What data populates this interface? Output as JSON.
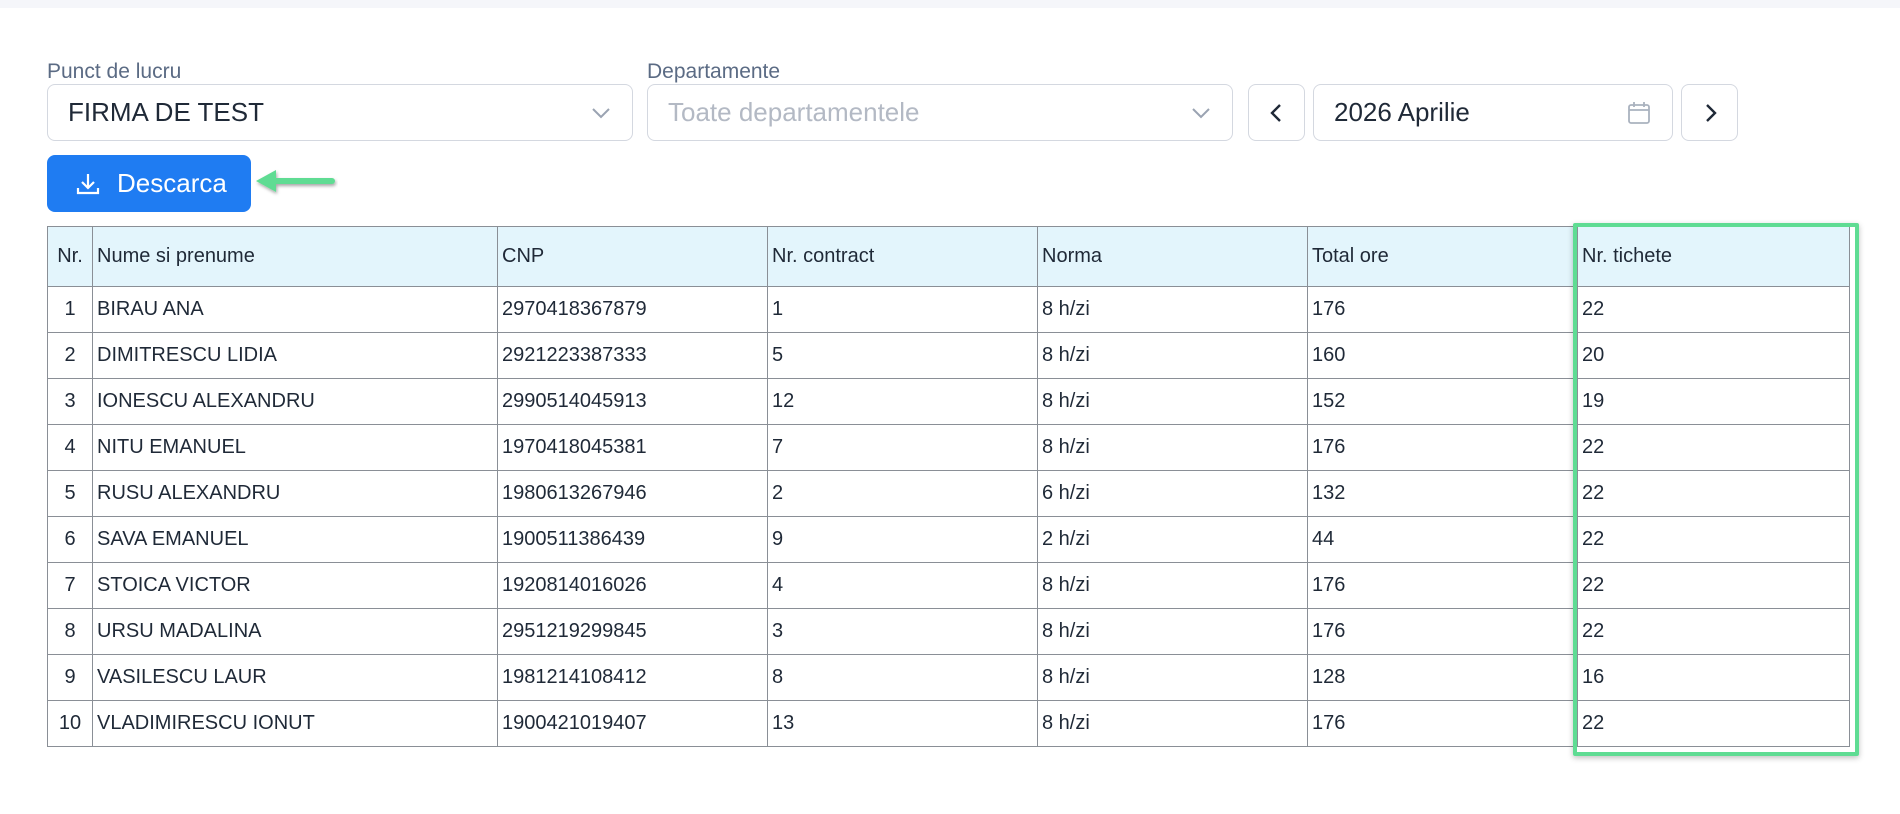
{
  "filters": {
    "workplace_label": "Punct de lucru",
    "workplace_value": "FIRMA DE TEST",
    "department_label": "Departamente",
    "department_placeholder": "Toate departamentele",
    "month_value": "2026 Aprilie"
  },
  "actions": {
    "download_label": "Descarca"
  },
  "icons": {
    "workplace_chevron": "chevron-down-icon",
    "department_chevron": "chevron-down-icon",
    "prev": "chevron-left-icon",
    "next": "chevron-right-icon",
    "calendar": "calendar-icon",
    "download": "download-icon",
    "annotation_arrow": "arrow-left-icon"
  },
  "colors": {
    "primary": "#1f7cf2",
    "header_bg": "#e3f5fc",
    "highlight": "#5fdc93"
  },
  "table": {
    "columns": [
      "Nr.",
      "Nume si prenume",
      "CNP",
      "Nr. contract",
      "Norma",
      "Total ore",
      "Nr. tichete"
    ],
    "rows": [
      [
        "1",
        "BIRAU ANA",
        "2970418367879",
        "1",
        "8 h/zi",
        "176",
        "22"
      ],
      [
        "2",
        "DIMITRESCU LIDIA",
        "2921223387333",
        "5",
        "8 h/zi",
        "160",
        "20"
      ],
      [
        "3",
        "IONESCU ALEXANDRU",
        "2990514045913",
        "12",
        "8 h/zi",
        "152",
        "19"
      ],
      [
        "4",
        "NITU EMANUEL",
        "1970418045381",
        "7",
        "8 h/zi",
        "176",
        "22"
      ],
      [
        "5",
        "RUSU ALEXANDRU",
        "1980613267946",
        "2",
        "6 h/zi",
        "132",
        "22"
      ],
      [
        "6",
        "SAVA EMANUEL",
        "1900511386439",
        "9",
        "2 h/zi",
        "44",
        "22"
      ],
      [
        "7",
        "STOICA VICTOR",
        "1920814016026",
        "4",
        "8 h/zi",
        "176",
        "22"
      ],
      [
        "8",
        "URSU MADALINA",
        "2951219299845",
        "3",
        "8 h/zi",
        "176",
        "22"
      ],
      [
        "9",
        "VASILESCU LAUR",
        "1981214108412",
        "8",
        "8 h/zi",
        "128",
        "16"
      ],
      [
        "10",
        "VLADIMIRESCU IONUT",
        "1900421019407",
        "13",
        "8 h/zi",
        "176",
        "22"
      ]
    ]
  }
}
